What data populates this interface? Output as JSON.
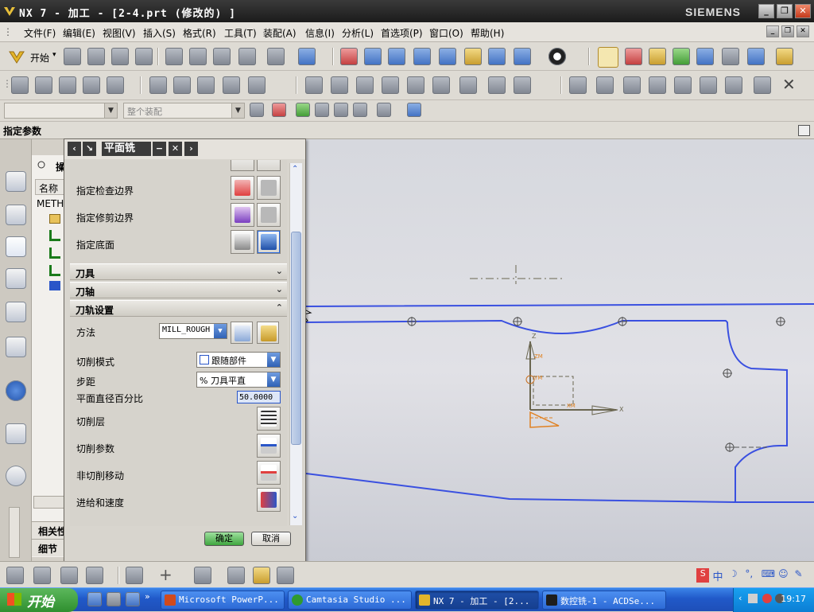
{
  "window": {
    "title": "NX 7 - 加工 - [2-4.prt (修改的) ]",
    "brand": "SIEMENS",
    "controls": {
      "minimize": "_",
      "restore": "❐",
      "close": "✕"
    }
  },
  "menu": {
    "items": [
      "文件(F)",
      "编辑(E)",
      "视图(V)",
      "插入(S)",
      "格式(R)",
      "工具(T)",
      "装配(A)",
      "信息(I)",
      "分析(L)",
      "首选项(P)",
      "窗口(O)",
      "帮助(H)"
    ]
  },
  "toolbar": {
    "start_label": "开始",
    "selection_filter_placeholder": "整个装配"
  },
  "cue_line": "指定参数",
  "navigator": {
    "header": "操",
    "column_name": "名称",
    "root": "METH",
    "related_label": "相关性",
    "details_label": "细节"
  },
  "dialog": {
    "title": "平面铣",
    "rows": {
      "check_boundary": "指定检查边界",
      "trim_boundary": "指定修剪边界",
      "floor": "指定底面"
    },
    "sections": {
      "tool": "刀具",
      "tool_axis": "刀轴",
      "path_settings": "刀轨设置"
    },
    "method_label": "方法",
    "method_value": "MILL_ROUGH",
    "cut_pattern_label": "切削模式",
    "cut_pattern_value": "跟随部件",
    "stepover_label": "步距",
    "stepover_value": "% 刀具平直",
    "percent_label": "平面直径百分比",
    "percent_value": "50.0000",
    "cut_levels": "切削层",
    "cut_params": "切削参数",
    "non_cut_moves": "非切削移动",
    "feeds_speeds": "进给和速度",
    "ok": "确定",
    "cancel": "取消"
  },
  "graphics": {
    "axis_x": "X",
    "axis_y": "Y",
    "axis_z": "Z",
    "axis_xm": "XM",
    "axis_ym": "YM",
    "axis_zm": "ZM",
    "profile_color": "#3a50e0"
  },
  "taskbar": {
    "start": "开始",
    "tasks": [
      "Microsoft PowerP...",
      "Camtasia Studio ...",
      "NX 7 - 加工 - [2...",
      "数控铣-1 - ACDSe..."
    ],
    "clock": "19:17"
  },
  "icons": [
    "siemens-nx-logo-icon",
    "start-icon",
    "new-icon",
    "open-icon",
    "save-icon",
    "cut-icon",
    "copy-icon",
    "paste-icon",
    "delete-icon",
    "undo-icon",
    "fit-icon",
    "zoom-icon",
    "rotate-icon",
    "wcs-icon",
    "edit-icon",
    "mill-icon",
    "close-icon"
  ]
}
